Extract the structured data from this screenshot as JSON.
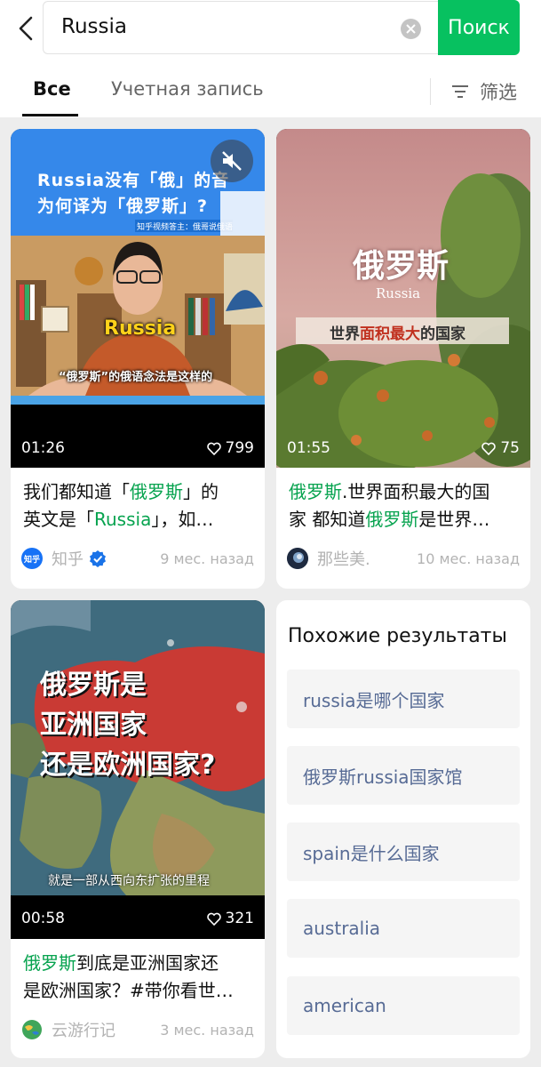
{
  "search": {
    "query": "Russia",
    "button_label": "Поиск",
    "colors": {
      "accent": "#07c160",
      "highlight": "#07a34f",
      "link": "#576b95"
    }
  },
  "tabs": [
    {
      "label": "Все",
      "active": true
    },
    {
      "label": "Учетная запись",
      "active": false
    }
  ],
  "filter_label": "筛选",
  "results": [
    {
      "thumb_title_1": "Russia没有「俄」的音",
      "thumb_title_2": "为何译为「俄罗斯」?",
      "thumb_tag": "知乎视频答主：俄哥说俄语",
      "thumb_caption": "Russia",
      "thumb_sub": "“俄罗斯”的俄语念法是这样的",
      "duration": "01:26",
      "likes": "799",
      "desc_parts": [
        "我们都知道「",
        "俄罗斯",
        "」的",
        "英文是「",
        "Russia",
        "」，如…"
      ],
      "author": "知乎",
      "avatar_text": "知乎",
      "verified": true,
      "time": "9 мес. назад",
      "muted_icon": "mute-icon"
    },
    {
      "thumb_title": "俄罗斯",
      "thumb_sub": "Russia",
      "thumb_banner_1": "世界",
      "thumb_banner_2": "面积最大",
      "thumb_banner_3": "的国家",
      "duration": "01:55",
      "likes": "75",
      "desc_parts": [
        "俄罗斯",
        ".世界面积最大的国",
        "家 都知道",
        "俄罗斯",
        "是世界…"
      ],
      "author": "那些美.",
      "time": "10 мес. назад"
    },
    {
      "thumb_title_1": "俄罗斯是",
      "thumb_title_2": "亚洲国家",
      "thumb_title_3": "还是欧洲国家?",
      "thumb_sub": "就是一部从西向东扩张的里程",
      "duration": "00:58",
      "likes": "321",
      "desc_parts": [
        "俄罗斯",
        "到底是亚洲国家还",
        "是欧洲国家？#带你看世…"
      ],
      "author": "云游行记",
      "time": "3 мес. назад"
    }
  ],
  "related": {
    "title": "Похожие результаты",
    "items": [
      "russia是哪个国家",
      "俄罗斯russia国家馆",
      "spain是什么国家",
      "australia",
      "american"
    ]
  }
}
